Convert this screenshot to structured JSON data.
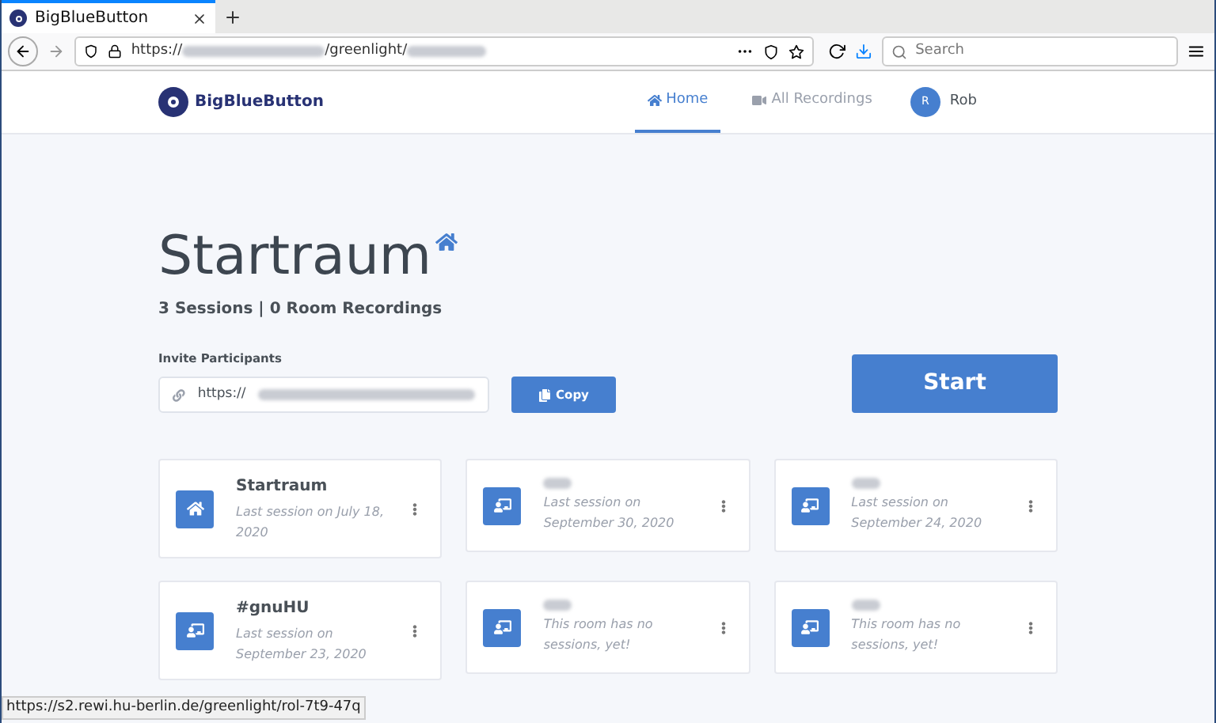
{
  "browser": {
    "tab_title": "BigBlueButton",
    "url_scheme": "https://",
    "url_path": "/greenlight/",
    "search_placeholder": "Search"
  },
  "header": {
    "logo_text": "BigBlueButton",
    "nav": [
      {
        "label": "Home",
        "kind": "home",
        "selected": true
      },
      {
        "label": "All Recordings",
        "kind": "recordings",
        "selected": false
      }
    ],
    "avatar_initial": "R",
    "user_name": "Rob"
  },
  "room": {
    "title": "Startraum",
    "stats": "3 Sessions | 0 Room Recordings",
    "invite_label": "Invite Participants",
    "invite_url": "https://",
    "copy_button": "Copy",
    "start_button": "Start"
  },
  "rooms": [
    {
      "kind": "home",
      "name": "Startraum",
      "last_session": "Last session on July 18, 2020"
    },
    {
      "kind": "room",
      "last_session": "Last session on September 30, 2020"
    },
    {
      "kind": "room",
      "last_session": "Last session on September 24, 2020"
    },
    {
      "kind": "room",
      "name": "#gnuHU",
      "last_session": "Last session on September 23, 2020"
    },
    {
      "kind": "room",
      "last_session": "This room has no sessions, yet!"
    },
    {
      "kind": "room",
      "last_session": "This room has no sessions, yet!"
    }
  ],
  "status_url": "https://s2.rewi.hu-berlin.de/greenlight/rol-7t9-47q"
}
